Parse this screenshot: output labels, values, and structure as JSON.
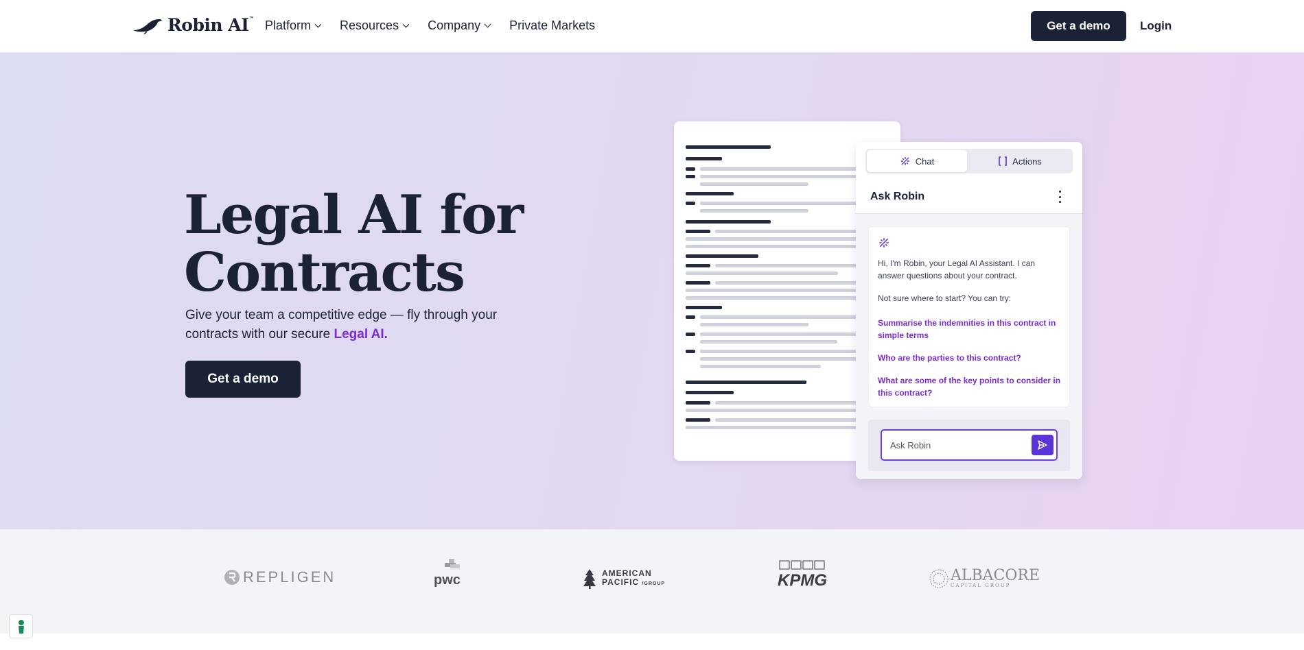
{
  "nav": {
    "logo_text": "Robin AI",
    "logo_tm": "™",
    "links": [
      {
        "label": "Platform"
      },
      {
        "label": "Resources"
      },
      {
        "label": "Company"
      },
      {
        "label": "Private Markets"
      }
    ],
    "demo_label": "Get a demo",
    "login_label": "Login"
  },
  "hero": {
    "title_line1": "Legal AI for",
    "title_line2": "Contracts",
    "subtitle_prefix": "Give your team a competitive edge — fly through your contracts with our secure ",
    "subtitle_highlight": "Legal AI.",
    "cta_label": "Get a demo"
  },
  "chat": {
    "tab_chat": "Chat",
    "tab_actions": "Actions",
    "title": "Ask Robin",
    "intro": "Hi, I'm Robin, your Legal AI Assistant. I can answer questions about your contract.",
    "prompt": "Not sure where to start? You can try:",
    "suggestions": [
      "Summarise the indemnities in this contract in simple terms",
      "Who are the parties to this contract?",
      "What are some of the key points to consider in this contract?"
    ],
    "input_placeholder": "Ask Robin"
  },
  "logos": {
    "repligen": "REPLIGEN",
    "pwc": "pwc",
    "american_line1": "AMERICAN",
    "american_line2": "PACIFIC",
    "american_line2_suffix": "/GROUP",
    "kpmg": "KPMG",
    "albacore": "ALBACORE",
    "albacore_sub": "CAPITAL GROUP"
  },
  "colors": {
    "navy": "#1c2236",
    "purple": "#7a2bd6",
    "send_button": "#5b34d8"
  }
}
